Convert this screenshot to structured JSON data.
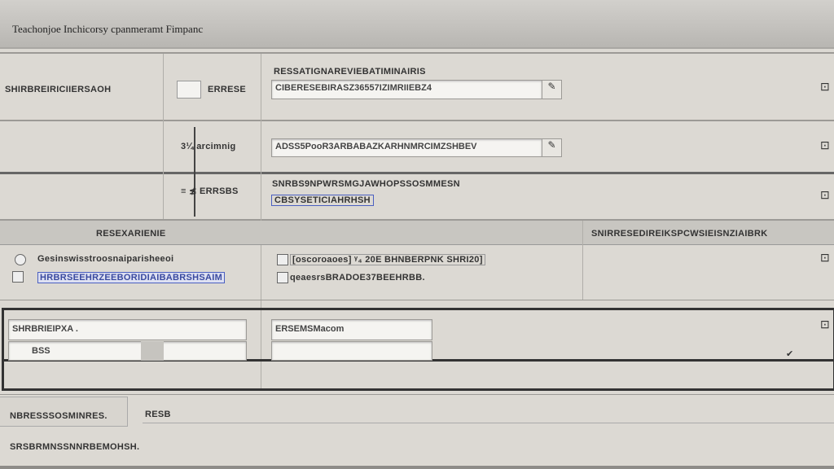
{
  "window": {
    "title": "Teachonjoe Inchicorsy cpanmeramt Fimpanc"
  },
  "row1": {
    "label": "SHIRBREIRICIIERSAOH",
    "check_label": "ERRESE",
    "field_label": "RESSATIGNAREVIEBATIMINAIRIS",
    "field_value": "CIBERESEBIRASZ36557IZIMRIIEBZ4",
    "edit": "✎",
    "side_icon": "⊡"
  },
  "row2": {
    "label": "3¼ arcimnig",
    "field_value": "ADSS5PooR3ARBABAZKARHNMRCIMZSHBEV",
    "edit": "✎",
    "side_icon": "⊡"
  },
  "row3": {
    "label": "≡ ≴ ERRSBS",
    "field_label": "SNRBS9NPWRSMGJAWHOPSSOSMMESN",
    "link": "CBSYSETICIAHRHSH",
    "side_icon": "⊡"
  },
  "section": {
    "col1_header": "RESEXARIENIE",
    "col3_header": "SNIRRESEDIREIKSPCWSIEISNZIAIBRK",
    "items": [
      {
        "label": "Gesinswisstroosnaiparisheeoi"
      },
      {
        "label": "HRBRSEEHRZEEBORIDIAIBABRSHSAIM"
      }
    ],
    "mid_items": [
      {
        "label": "[oscoroaoes] ᵞ₄ 20E BHNBERPNK SHRI20]"
      },
      {
        "label": "qeaesrsBRADOE37BEEHRBB."
      }
    ],
    "side_icon": "⊡"
  },
  "boxed": {
    "field1": "SHRBRIEIPXA .",
    "field2": "BSS",
    "field3": "ERSEMSMacom",
    "check": "✔",
    "side_icon": "⊡"
  },
  "bottom": {
    "label": "NBRESSSOSMINRES.",
    "value": "RESB",
    "footer": "SRSBRMNSSNNRBEMOHSH."
  }
}
